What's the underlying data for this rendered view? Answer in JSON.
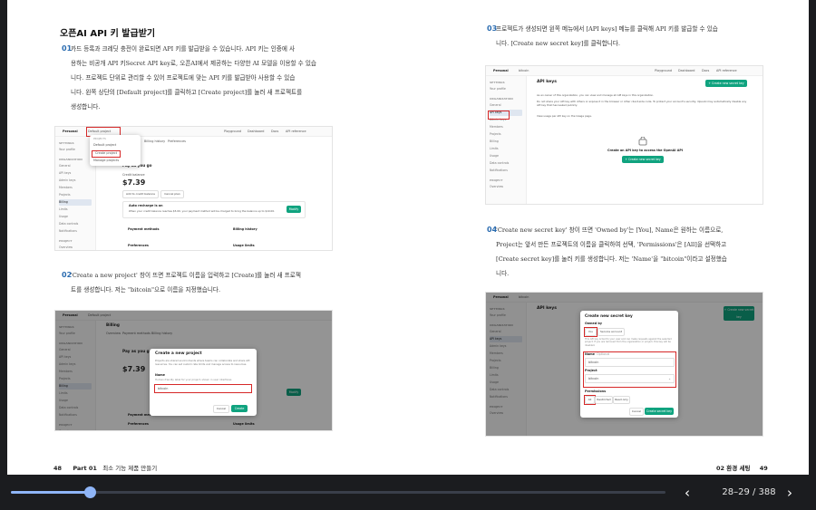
{
  "left_page": {
    "section_title": "오픈AI API 키 발급받기",
    "steps": [
      {
        "num": "01",
        "lines": [
          "카드 등록과 크레딧 충전이 완료되면 API 키를 발급받을 수 있습니다. API 키는 인증에 사",
          "용하는 비공개 API 키Secret API key로, 오픈AI에서 제공하는 다양한 AI 모델을 이용할 수 있습",
          "니다. 프로젝트 단위로 관리할 수 있어 프로젝트에 맞는 API 키를 발급받아 사용할 수 있습",
          "니다. 왼쪽 상단의 [Default project]를 클릭하고 [Create project]를 눌러 새 프로젝트를",
          "생성합니다."
        ]
      },
      {
        "num": "02",
        "lines": [
          "'Create a new project' 창이 뜨면 프로젝트 이름을 입력하고 [Create]를 눌러 새 프로젝",
          "트를 생성합니다. 저는 \"bitcoin\"으로 이름을 지정했습니다."
        ]
      }
    ],
    "shot1": {
      "org": "Personal",
      "project": "Default project",
      "menu_header": "PROJECTS",
      "menu_items": [
        "Default project",
        "Create project",
        "Manage projects"
      ],
      "tabs": [
        "Overview",
        "Payment methods",
        "Billing history",
        "Preferences"
      ],
      "plan": "Pay as you go",
      "credit_label": "Credit balance",
      "credit": "$7.39",
      "buttons": [
        "Add to credit balance",
        "Cancel plan"
      ],
      "auto_title": "Auto recharge is on",
      "auto_desc": "When your credit balance reaches $5.00, your payment method will be charged to bring the balance up to $10.00.",
      "modify": "Modify",
      "cards": [
        "Payment methods",
        "Billing history",
        "Preferences",
        "Usage limits"
      ],
      "nav_links": [
        "Playground",
        "Dashboard",
        "Docs",
        "API reference"
      ],
      "sidebar": [
        {
          "h": "SETTINGS"
        },
        {
          "t": "Your profile"
        },
        {
          "h": "ORGANIZATION"
        },
        {
          "t": "General"
        },
        {
          "t": "API keys"
        },
        {
          "t": "Admin keys"
        },
        {
          "t": "Members"
        },
        {
          "t": "Projects"
        },
        {
          "t": "Billing",
          "a": true
        },
        {
          "t": "Limits"
        },
        {
          "t": "Usage"
        },
        {
          "t": "Data controls"
        },
        {
          "t": "Notifications"
        },
        {
          "h": "PROJECT"
        },
        {
          "t": "Overview"
        }
      ]
    },
    "shot2": {
      "page_title": "Billing",
      "modal_title": "Create a new project",
      "modal_desc": "Projects are shared environments where teams can collaborate and share API resources. You can set custom rate limits and manage access to resources.",
      "learn_more": "Learn more.",
      "name_label": "Name",
      "name_help": "Human-friendly label for your project, shown in user interfaces",
      "name_value": "bitcoin",
      "cancel": "Cancel",
      "create": "Create"
    },
    "page_no": "48",
    "footer_part": "Part 01",
    "footer_text": "최소 기능 제품 만들기"
  },
  "right_page": {
    "steps": [
      {
        "num": "03",
        "lines": [
          "프로젝트가 생성되면 왼쪽 메뉴에서 [API keys] 메뉴를 클릭해 API 키를 발급할 수 있습",
          "니다. [Create new secret key]를 클릭합니다."
        ]
      },
      {
        "num": "04",
        "lines": [
          "'Create new secret key' 창이 뜨면 'Owned by'는 [You], Name은 원하는 이름으로,",
          "Project는 앞서 만든 프로젝트의 이름을 클릭하여 선택, 'Permissions'은 [All]을 선택하고",
          "[Create secret key]를 눌러 키를 생성합니다. 저는 'Name'을 \"bitcoin\"이라고 설정했습",
          "니다."
        ]
      }
    ],
    "shot3": {
      "page_title": "API keys",
      "create_btn": "+ Create new secret key",
      "desc1": "As an owner of this organization, you can view and manage all API keys in this organization.",
      "desc2": "Do not share your API key with others or expose it in the browser or other client-side code. To protect your account's security, OpenAI may automatically disable any API key that has leaked publicly.",
      "desc3": "View usage per API key on the Usage page.",
      "center_title": "Create an API key to access the OpenAI API",
      "center_btn": "+ Create new secret key"
    },
    "shot4": {
      "modal_title": "Create new secret key",
      "owned_by": "Owned by",
      "owned_opts": [
        "You",
        "Service account"
      ],
      "owned_desc": "This API key is tied to your user and can make requests against the selected project. If you are removed from the organization or project, this key will be disabled.",
      "name_label": "Name",
      "name_opt": "Optional",
      "name_value": "bitcoin",
      "project_label": "Project",
      "project_value": "bitcoin",
      "perm_label": "Permissions",
      "perm_opts": [
        "All",
        "Restricted",
        "Read only"
      ],
      "cancel": "Cancel",
      "create": "Create secret key"
    },
    "page_no": "49",
    "footer_text": "02 환경 세팅"
  },
  "viewer": {
    "progress": 0.12,
    "page_indicator": "28–29 / 388",
    "prev_icon": "chevron-left-icon",
    "next_icon": "chevron-right-icon"
  }
}
